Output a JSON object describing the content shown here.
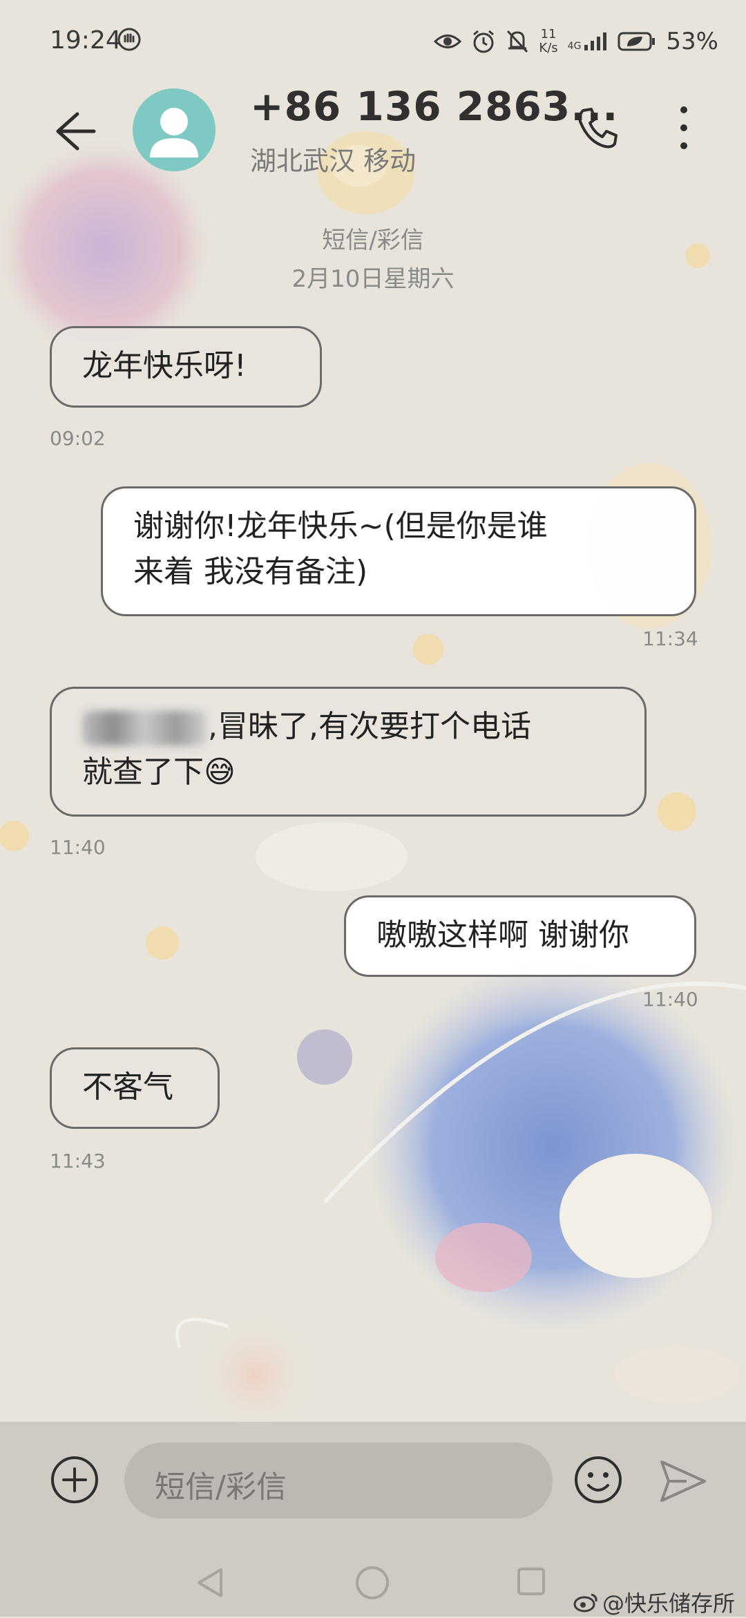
{
  "status_bar": {
    "time": "19:24",
    "net_speed_top": "11",
    "net_speed_bottom": "K/s",
    "signal_label": "4G",
    "battery": "53%",
    "icons": [
      "hand-icon",
      "eye-icon",
      "alarm-icon",
      "mute-icon",
      "signal-icon",
      "battery-icon"
    ]
  },
  "header": {
    "contact_number": "+86 136 2863...",
    "contact_location": "湖北武汉 移动"
  },
  "thread": {
    "channel": "短信/彩信",
    "date": "2月10日星期六"
  },
  "messages": [
    {
      "direction": "in",
      "text": "龙年快乐呀!",
      "time": "09:02"
    },
    {
      "direction": "out",
      "text_line1": "谢谢你!龙年快乐~(但是你是谁",
      "text_line2": "来着 我没有备注)",
      "time": "11:34"
    },
    {
      "direction": "in",
      "text_line1": ",冒昧了,有次要打个电话",
      "text_line2": "就查了下😅",
      "time": "11:40"
    },
    {
      "direction": "out",
      "text": "嗷嗷这样啊 谢谢你",
      "time": "11:40"
    },
    {
      "direction": "in",
      "text": "不客气",
      "time": "11:43"
    }
  ],
  "input": {
    "placeholder": "短信/彩信"
  },
  "watermark": "@快乐储存所",
  "colors": {
    "bubble_border": "#6a6a6a",
    "avatar": "#7fc9c4",
    "input_bar": "#cdc8c2"
  }
}
